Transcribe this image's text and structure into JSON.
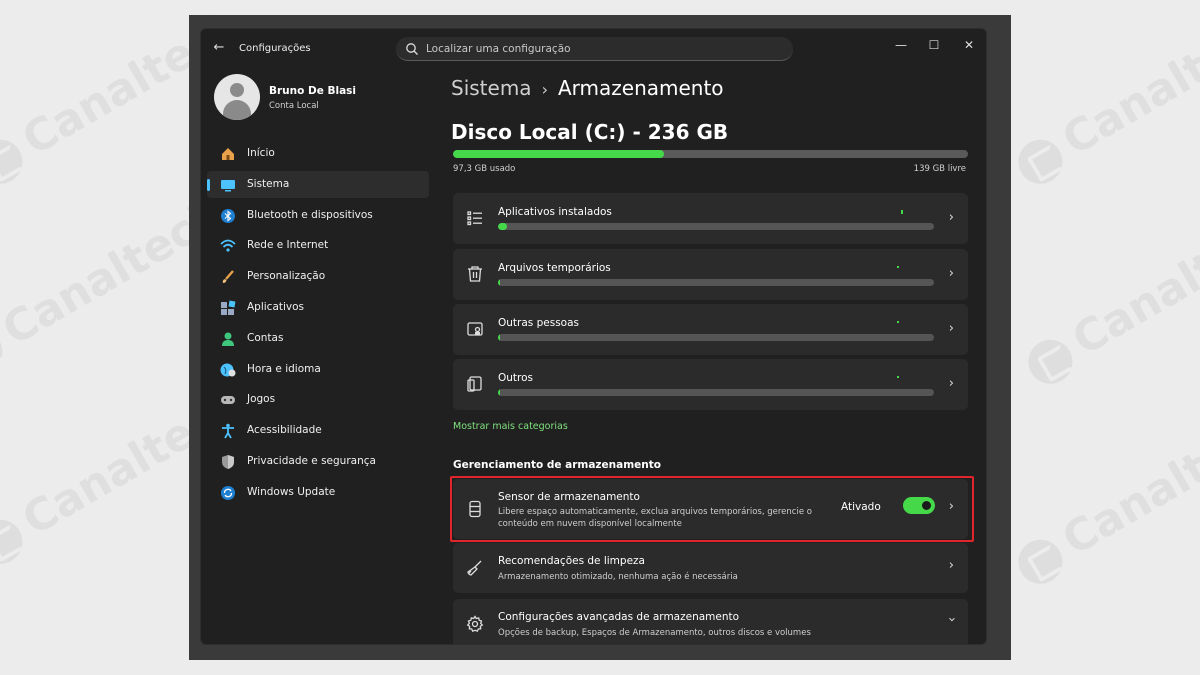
{
  "watermark": "Canaltech",
  "app": {
    "title": "Configurações",
    "search_placeholder": "Localizar uma configuração"
  },
  "user": {
    "name": "Bruno De Blasi",
    "account": "Conta Local"
  },
  "nav": [
    {
      "label": "Início",
      "icon": "home-icon",
      "color": "#e8a04a"
    },
    {
      "label": "Sistema",
      "icon": "system-icon",
      "color": "#4cc2ff",
      "active": true
    },
    {
      "label": "Bluetooth e dispositivos",
      "icon": "bluetooth-icon",
      "color": "#4cc2ff"
    },
    {
      "label": "Rede e Internet",
      "icon": "network-icon",
      "color": "#4cc2ff"
    },
    {
      "label": "Personalização",
      "icon": "brush-icon",
      "color": "#e8a04a"
    },
    {
      "label": "Aplicativos",
      "icon": "apps-icon",
      "color": "#9aa9c4"
    },
    {
      "label": "Contas",
      "icon": "accounts-icon",
      "color": "#3fc77e"
    },
    {
      "label": "Hora e idioma",
      "icon": "time-language-icon",
      "color": "#4cc2ff"
    },
    {
      "label": "Jogos",
      "icon": "gaming-icon",
      "color": "#b8b8b8"
    },
    {
      "label": "Acessibilidade",
      "icon": "accessibility-icon",
      "color": "#4cc2ff"
    },
    {
      "label": "Privacidade e segurança",
      "icon": "shield-icon",
      "color": "#b8b8b8"
    },
    {
      "label": "Windows Update",
      "icon": "update-icon",
      "color": "#4cc2ff"
    }
  ],
  "breadcrumb": {
    "parent": "Sistema",
    "separator": "›",
    "current": "Armazenamento"
  },
  "disk": {
    "title": "Disco Local (C:) - 236 GB",
    "used_label": "97,3 GB usado",
    "free_label": "139 GB livre",
    "used_fraction": 0.41
  },
  "categories": [
    {
      "label": "Aplicativos instalados",
      "icon": "list-icon",
      "fraction": 0.02
    },
    {
      "label": "Arquivos temporários",
      "icon": "trash-icon",
      "fraction": 0.0
    },
    {
      "label": "Outras pessoas",
      "icon": "user-folder-icon",
      "fraction": 0.0
    },
    {
      "label": "Outros",
      "icon": "document-icon",
      "fraction": 0.005
    }
  ],
  "more_categories_link": "Mostrar mais categorias",
  "management": {
    "title": "Gerenciamento de armazenamento",
    "items": [
      {
        "title": "Sensor de armazenamento",
        "desc_line1": "Libere espaço automaticamente, exclua arquivos temporários, gerencie o",
        "desc_line2": "conteúdo em nuvem disponível localmente",
        "toggle_label": "Ativado",
        "toggle_on": true,
        "icon": "drive-icon"
      },
      {
        "title": "Recomendações de limpeza",
        "desc": "Armazenamento otimizado, nenhuma ação é necessária",
        "icon": "broom-icon"
      },
      {
        "title": "Configurações avançadas de armazenamento",
        "desc": "Opções de backup, Espaços de Armazenamento, outros discos e volumes",
        "icon": "gear-icon"
      }
    ]
  }
}
